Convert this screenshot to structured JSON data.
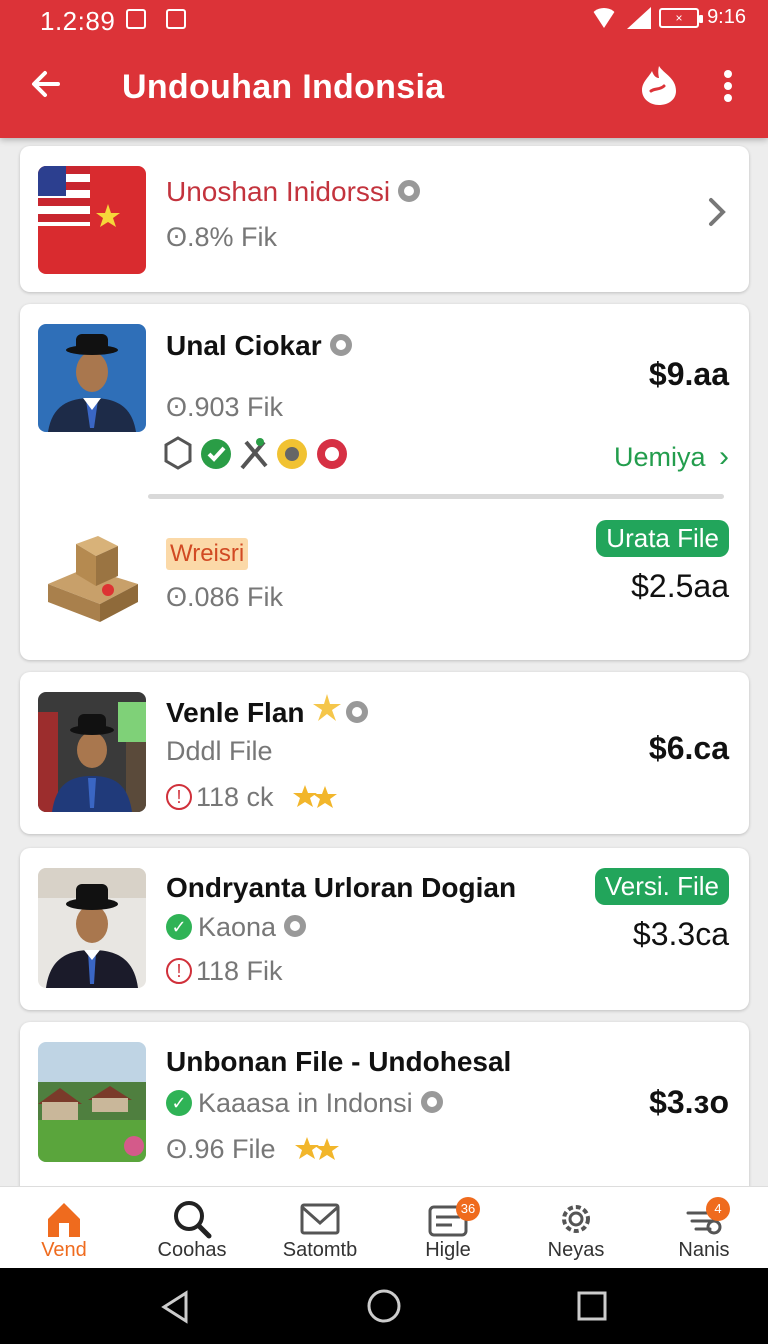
{
  "status_bar": {
    "time": "1.2:89",
    "battery": "9:16"
  },
  "app_bar": {
    "title": "Undouhan Indonsia"
  },
  "cards": {
    "flag": {
      "name": "Unoshan Inidorssi",
      "sub": "ʘ.8% Fik"
    },
    "profile": {
      "name": "Unal Ciokar",
      "sub": "ʘ.903 Fik",
      "price": "$9.aa",
      "link": "Uemiya",
      "link_chevron": "›"
    },
    "package": {
      "tag": "Wreisri",
      "sub": "ʘ.086 Fik",
      "pill": "Urata File",
      "price": "$2.5aa"
    },
    "venle": {
      "name": "Venle Flan",
      "sub1": "Dddl File",
      "sub2": "118 ck",
      "price": "$6.ca"
    },
    "ondryanta": {
      "name": "Ondryanta Urloran Dogian",
      "sub1": "Kaona",
      "sub2": "118 Fik",
      "pill": "Versi. File",
      "price": "$3.3ca"
    },
    "unbonan": {
      "name": "Unbonan File - Undohesal",
      "sub1": "Kaaasa in Indonsi",
      "sub2": "ʘ.96 File",
      "price": "$3.зo"
    }
  },
  "bottom_nav": {
    "items": [
      {
        "label": "Vend",
        "icon": "home-icon"
      },
      {
        "label": "Coohas",
        "icon": "search-icon"
      },
      {
        "label": "Satomtb",
        "icon": "mail-icon"
      },
      {
        "label": "Higle",
        "icon": "inbox-icon",
        "badge": "36"
      },
      {
        "label": "Neyas",
        "icon": "gear-icon"
      },
      {
        "label": "Nanis",
        "icon": "fast-icon",
        "badge": "4"
      }
    ]
  },
  "colors": {
    "accent": "#dc3338",
    "green": "#22a55b",
    "orange": "#ef6b1e"
  }
}
